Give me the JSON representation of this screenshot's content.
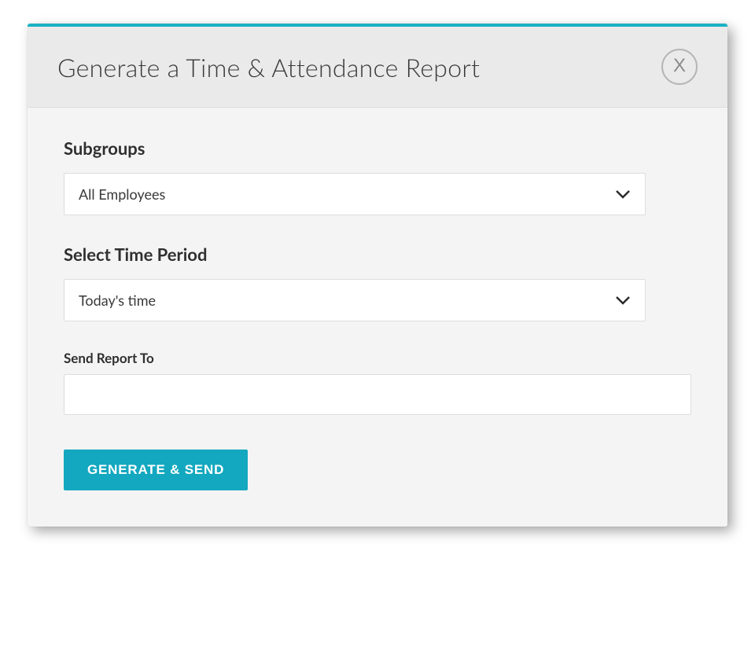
{
  "modal": {
    "title": "Generate a Time & Attendance Report",
    "close_label": "X"
  },
  "form": {
    "subgroups": {
      "label": "Subgroups",
      "selected": "All Employees"
    },
    "time_period": {
      "label": "Select Time Period",
      "selected": "Today's time"
    },
    "send_to": {
      "label": "Send Report To",
      "value": ""
    },
    "submit_label": "GENERATE & SEND"
  }
}
